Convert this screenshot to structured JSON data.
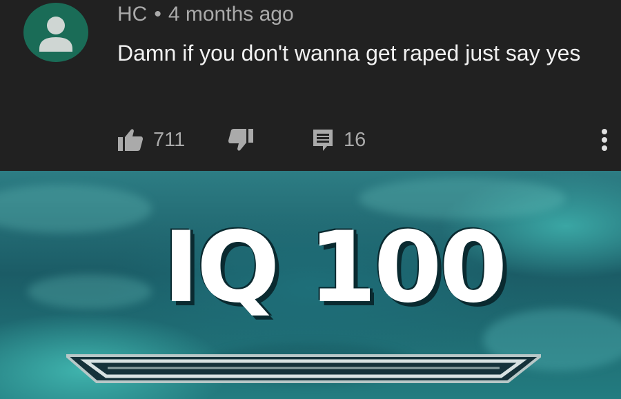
{
  "comment": {
    "author": "HC",
    "separator": "•",
    "time": "4 months ago",
    "text": "Damn if you don't wanna get raped just say yes",
    "likes": "711",
    "replies": "16",
    "icons": {
      "avatar": "avatar-person-icon",
      "like": "thumbs-up-icon",
      "dislike": "thumbs-down-icon",
      "reply": "comment-icon",
      "more": "more-vertical-icon"
    },
    "colors": {
      "avatar_bg": "#1a6c57",
      "background": "#212121",
      "meta": "#aaaaaa",
      "text": "#f1f1f1"
    }
  },
  "meme": {
    "caption": "IQ 100"
  }
}
